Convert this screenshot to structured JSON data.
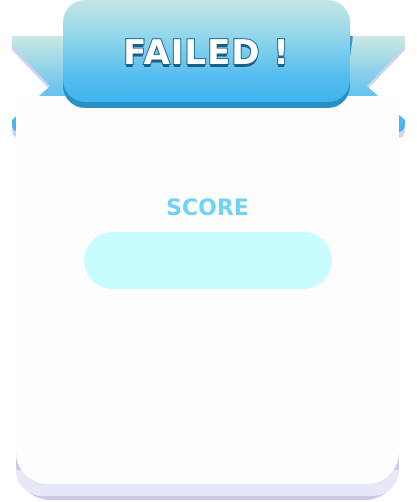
{
  "dialog": {
    "title": "FAILED !",
    "score_label": "SCORE",
    "score_value": ""
  },
  "colors": {
    "banner_top": "#c7e6e4",
    "banner_bottom": "#40b3ee",
    "banner_dark": "#2a8fc4",
    "score_label": "#6fd3f5",
    "score_box": "#c9fcff",
    "card": "#fdfdfd",
    "card_rim": "#c9cbe6"
  }
}
